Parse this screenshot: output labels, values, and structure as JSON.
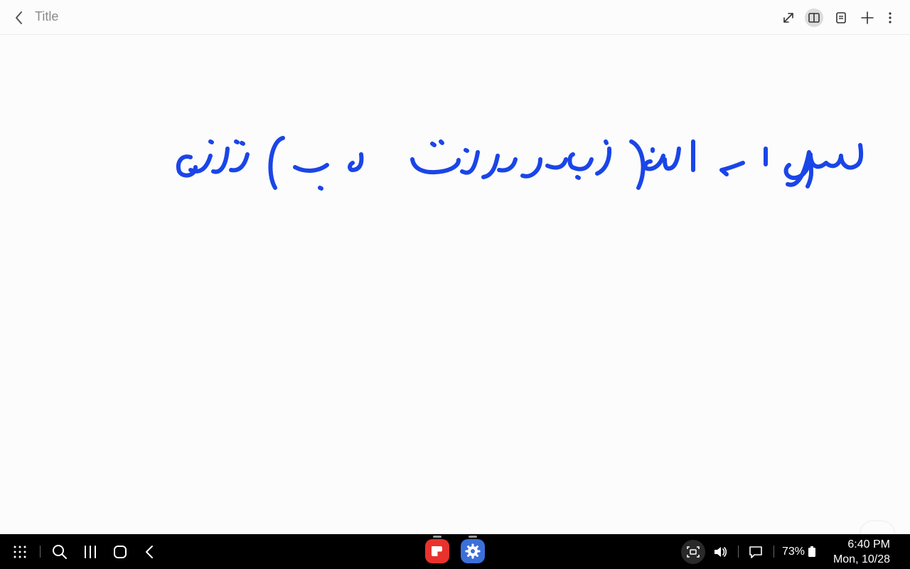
{
  "header": {
    "title": "Title"
  },
  "note": {
    "handwriting": "سوال ا ے الف) زیور وزینت ب) تباہ",
    "ink_color": "#1a45e8"
  },
  "taskbar": {
    "battery": "73%",
    "time": "6:40 PM",
    "date": "Mon, 10/28",
    "apps": [
      "samsung-notes-app-icon",
      "settings-app-icon"
    ]
  },
  "colors": {
    "notes_app": "#e8322d",
    "settings_app": "#3d6fd9",
    "active_toolbar_bg": "#dcdcdc"
  }
}
